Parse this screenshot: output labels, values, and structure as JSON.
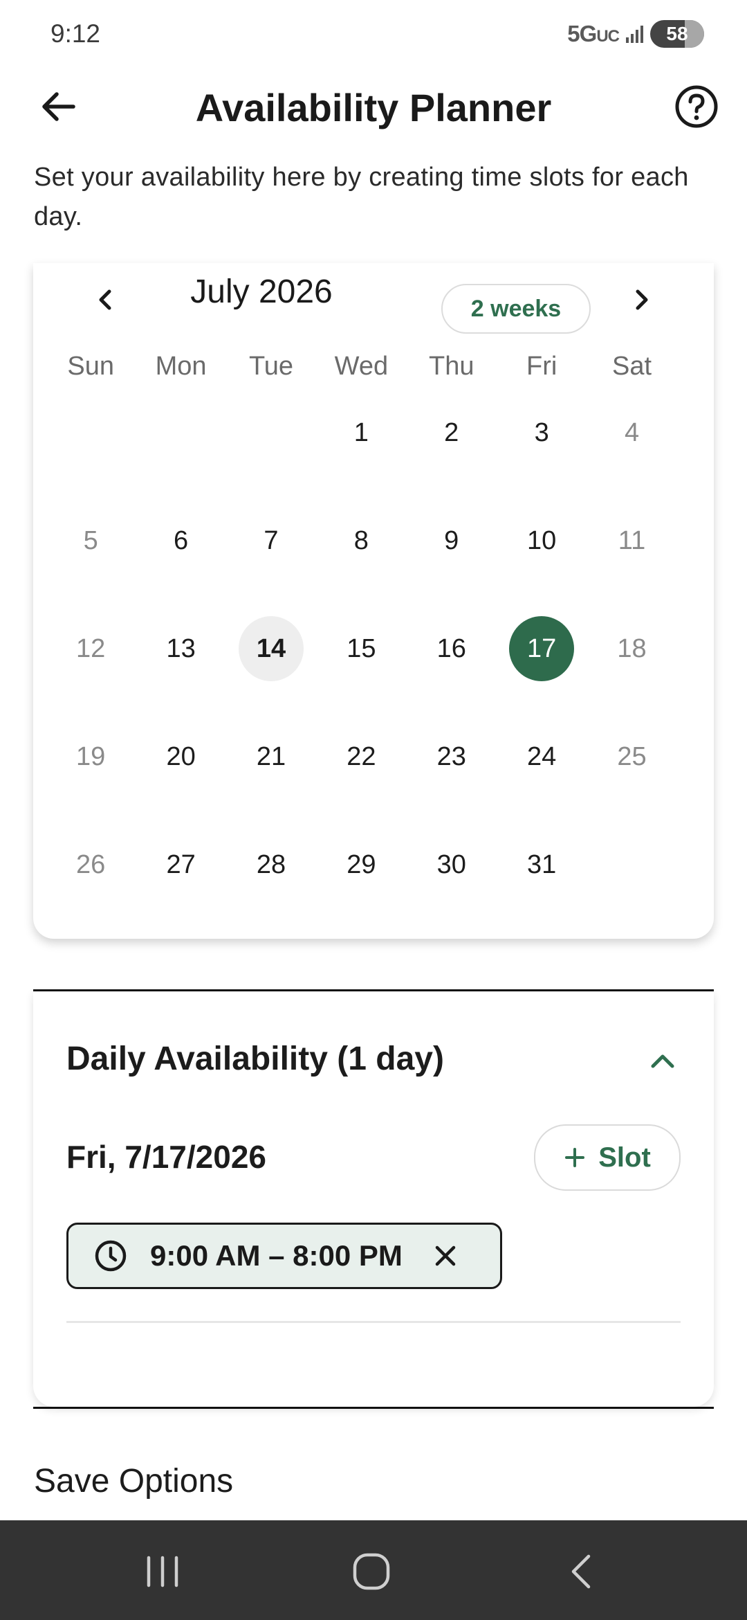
{
  "status_bar": {
    "time": "9:12",
    "network": "5G",
    "network_suffix": "UC",
    "battery": "58"
  },
  "header": {
    "title": "Availability Planner",
    "back_icon": "arrow-left-icon",
    "help_icon": "question-circle-icon"
  },
  "intro": {
    "text": "Set your availability here by creating time slots for each day."
  },
  "calendar": {
    "month_label": "July 2026",
    "range_chip": "2 weeks",
    "weekdays": [
      "Sun",
      "Mon",
      "Tue",
      "Wed",
      "Thu",
      "Fri",
      "Sat"
    ],
    "days": [
      "",
      "",
      "",
      "1",
      "2",
      "3",
      "4",
      "5",
      "6",
      "7",
      "8",
      "9",
      "10",
      "11",
      "12",
      "13",
      "14",
      "15",
      "16",
      "17",
      "18",
      "19",
      "20",
      "21",
      "22",
      "23",
      "24",
      "25",
      "26",
      "27",
      "28",
      "29",
      "30",
      "31",
      ""
    ],
    "today": "14",
    "selected": "17",
    "selected_color": "#2e6b4c"
  },
  "daily": {
    "title": "Daily Availability (1 day)",
    "date_label": "Fri, 7/17/2026",
    "add_slot_label": "Slot",
    "slots": [
      {
        "time": "9:00 AM – 8:00 PM"
      }
    ],
    "accent_color": "#2f6f4f"
  },
  "save": {
    "heading": "Save Options"
  }
}
